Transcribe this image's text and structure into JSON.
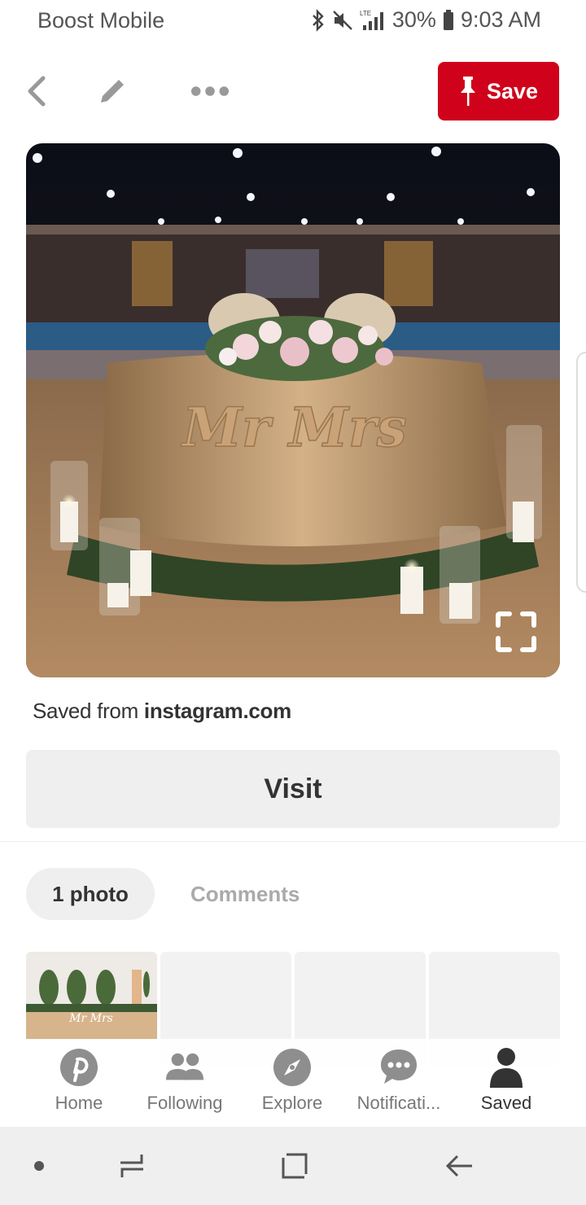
{
  "status_bar": {
    "carrier": "Boost Mobile",
    "network": "LTE",
    "battery": "30%",
    "time": "9:03 AM"
  },
  "toolbar": {
    "save_label": "Save",
    "save_color": "#d0021b"
  },
  "pin": {
    "image_description_icon": "wedding-sweetheart-table-photo",
    "sign_text": "Mr Mrs"
  },
  "source": {
    "prefix": "Saved from",
    "domain": "instagram.com"
  },
  "visit_label": "Visit",
  "tabs": [
    {
      "label": "1 photo",
      "active": true
    },
    {
      "label": "Comments",
      "active": false
    }
  ],
  "thumb_sign_text": "Mr Mrs",
  "bottom_nav": [
    {
      "label": "Home",
      "icon": "pinterest-icon"
    },
    {
      "label": "Following",
      "icon": "people-icon"
    },
    {
      "label": "Explore",
      "icon": "compass-icon"
    },
    {
      "label": "Notificati...",
      "icon": "chat-bubble-icon"
    },
    {
      "label": "Saved",
      "icon": "person-icon",
      "active": true
    }
  ]
}
